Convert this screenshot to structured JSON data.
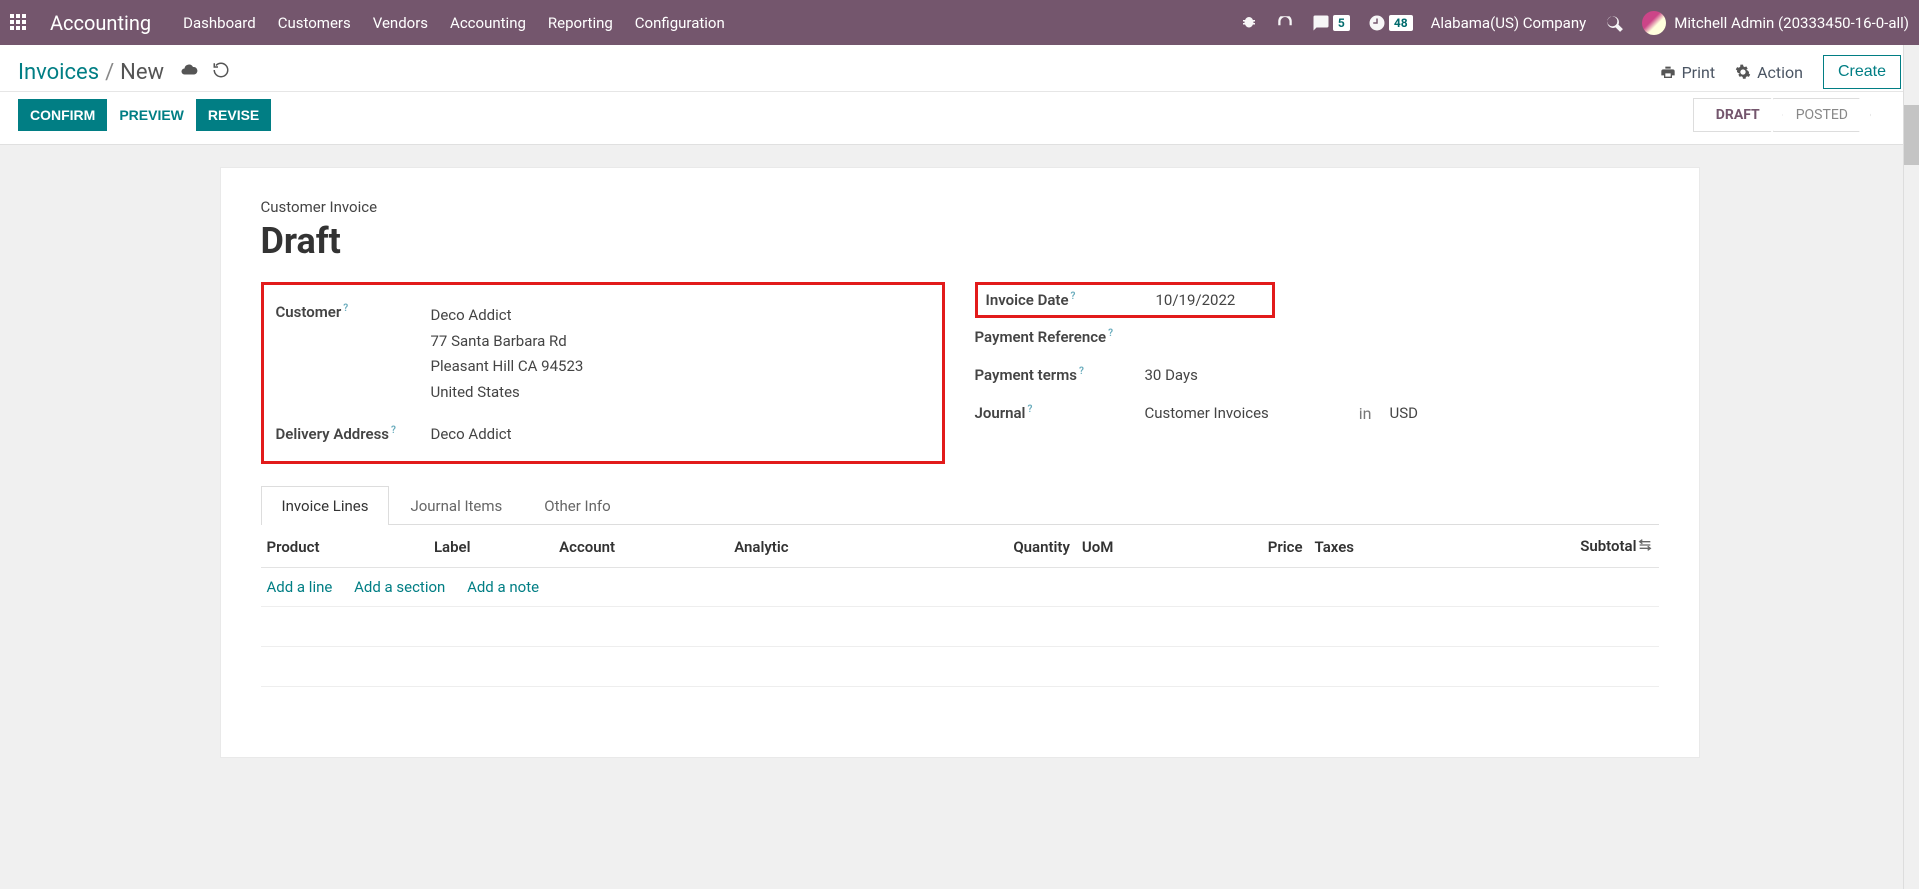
{
  "nav": {
    "app_name": "Accounting",
    "items": [
      "Dashboard",
      "Customers",
      "Vendors",
      "Accounting",
      "Reporting",
      "Configuration"
    ],
    "message_badge": "5",
    "activity_badge": "48",
    "company": "Alabama(US) Company",
    "user": "Mitchell Admin (20333450-16-0-all)"
  },
  "breadcrumb": {
    "root": "Invoices",
    "current": "New"
  },
  "controls": {
    "print": "Print",
    "action": "Action",
    "create": "Create"
  },
  "buttons": {
    "confirm": "CONFIRM",
    "preview": "PREVIEW",
    "revise": "REVISE"
  },
  "status": {
    "draft": "DRAFT",
    "posted": "POSTED"
  },
  "form": {
    "type_label": "Customer Invoice",
    "title": "Draft",
    "left": {
      "customer_label": "Customer",
      "customer": "Deco Addict",
      "addr1": "77 Santa Barbara Rd",
      "addr2": "Pleasant Hill CA 94523",
      "addr3": "United States",
      "delivery_label": "Delivery Address",
      "delivery": "Deco Addict"
    },
    "right": {
      "invoice_date_label": "Invoice Date",
      "invoice_date": "10/19/2022",
      "payment_ref_label": "Payment Reference",
      "payment_ref": "",
      "terms_label": "Payment terms",
      "terms": "30 Days",
      "journal_label": "Journal",
      "journal": "Customer Invoices",
      "journal_in": "in",
      "currency": "USD"
    }
  },
  "tabs": {
    "t1": "Invoice Lines",
    "t2": "Journal Items",
    "t3": "Other Info"
  },
  "table": {
    "cols": {
      "product": "Product",
      "label": "Label",
      "account": "Account",
      "analytic": "Analytic",
      "qty": "Quantity",
      "uom": "UoM",
      "price": "Price",
      "taxes": "Taxes",
      "subtotal": "Subtotal"
    },
    "actions": {
      "add_line": "Add a line",
      "add_section": "Add a section",
      "add_note": "Add a note"
    }
  }
}
